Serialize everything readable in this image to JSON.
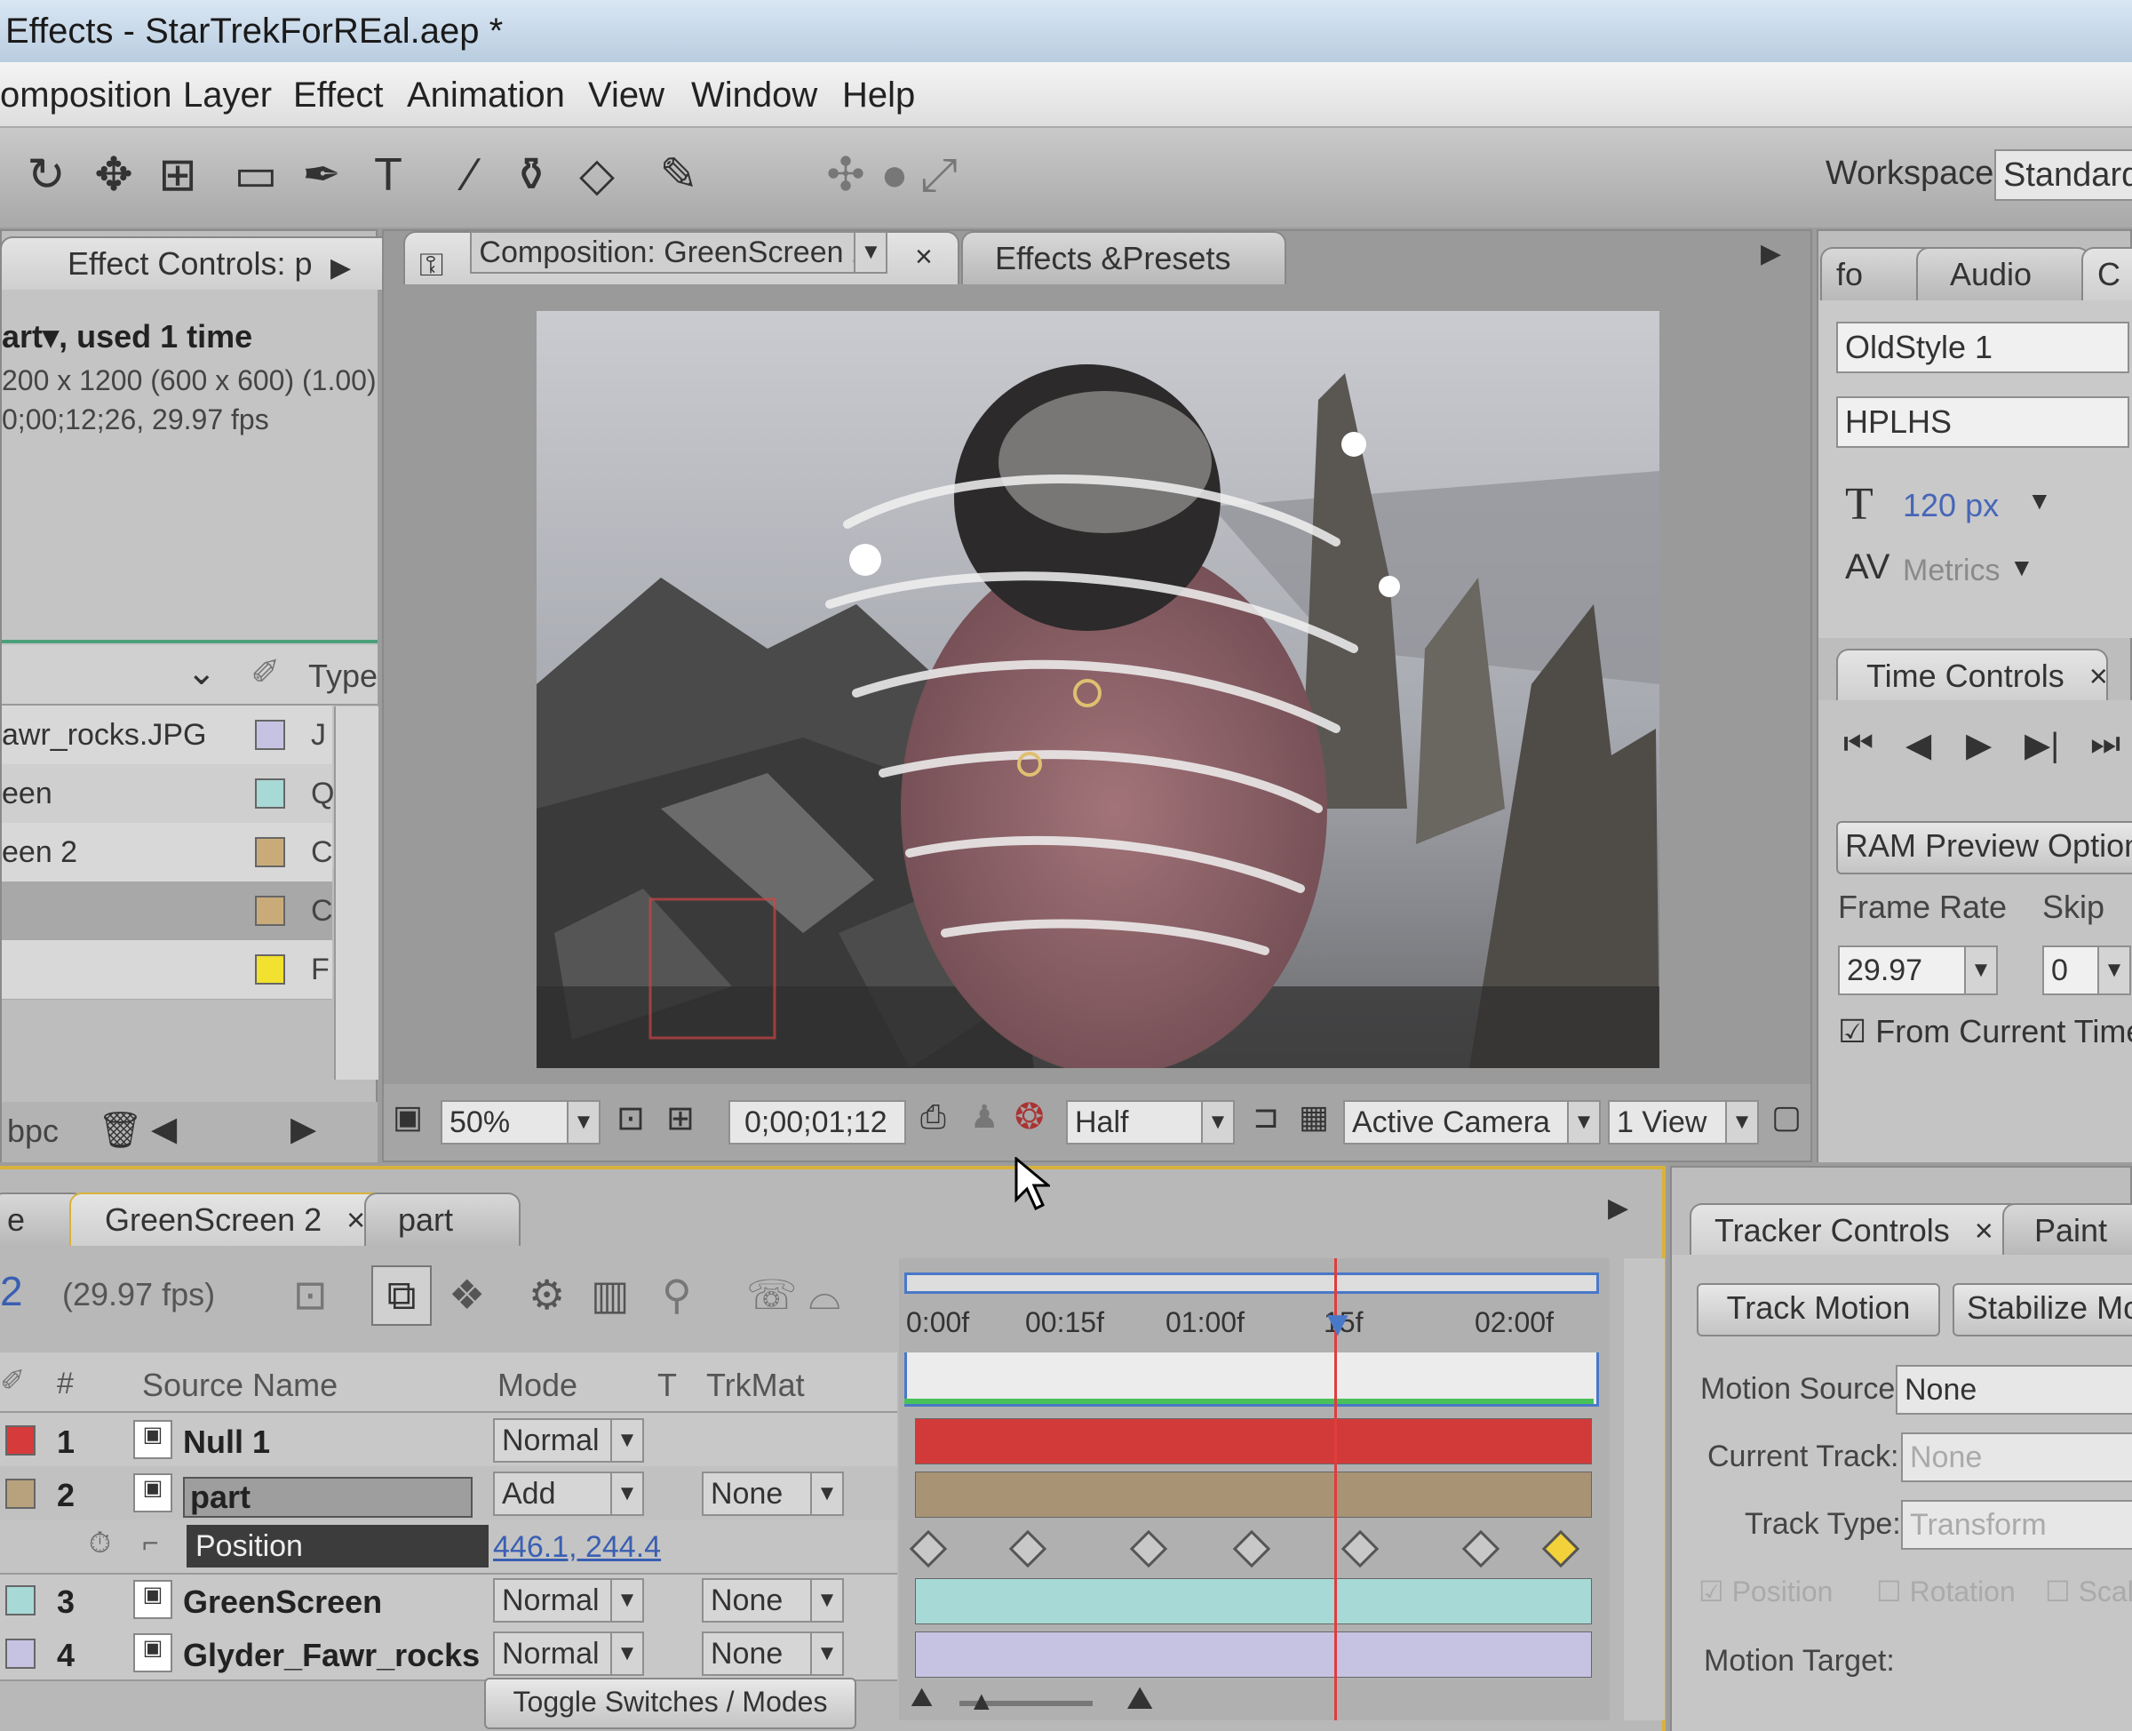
{
  "window": {
    "title": "Effects - StarTrekForREal.aep *"
  },
  "menu": [
    "omposition",
    "Layer",
    "Effect",
    "Animation",
    "View",
    "Window",
    "Help"
  ],
  "toolbar": {
    "workspace_label": "Workspace:",
    "workspace_value": "Standard"
  },
  "effect_controls": {
    "tab": "Effect Controls: p",
    "info_line1": "art▾, used 1 time",
    "info_line2": "200 x 1200  (600 x 600) (1.00)",
    "info_line3": "0;00;12;26, 29.97 fps",
    "col_type": "Type",
    "items": [
      {
        "name": "awr_rocks.JPG",
        "type": "J",
        "color": "#c6c3e2"
      },
      {
        "name": "een",
        "type": "Q",
        "color": "#a7d9d6"
      },
      {
        "name": "een 2",
        "type": "C",
        "color": "#c9ab7a"
      },
      {
        "name": "",
        "type": "C",
        "color": "#c9ab7a"
      },
      {
        "name": "",
        "type": "F",
        "color": "#f2e12e"
      }
    ],
    "footer_bpc": "bpc"
  },
  "composition": {
    "tab": "Composition: GreenScreen 2",
    "tab2": "Effects &Presets",
    "zoom": "50%",
    "timecode": "0;00;01;12",
    "resolution": "Half",
    "camera": "Active Camera",
    "views": "1 View"
  },
  "right_panel": {
    "tabs": [
      "fo",
      "Audio",
      "C"
    ],
    "font_family": "OldStyle 1",
    "font_style": "HPLHS",
    "font_size": "120 px",
    "kerning": "Metrics",
    "time_controls_tab": "Time Controls",
    "ram_preview": "RAM Preview Options",
    "frame_rate_label": "Frame Rate",
    "skip_label": "Skip",
    "frame_rate": "29.97",
    "skip": "0",
    "from_current_time": "From Current Time"
  },
  "timeline": {
    "tabs": [
      "e",
      "GreenScreen 2",
      "part"
    ],
    "comp_num": "2",
    "fps": "(29.97 fps)",
    "ruler": [
      "0:00f",
      "00:15f",
      "01:00f",
      "15f",
      "02:00f"
    ],
    "col_num": "#",
    "col_source": "Source Name",
    "col_mode": "Mode",
    "col_t": "T",
    "col_trkmat": "TrkMat",
    "layers": [
      {
        "num": "1",
        "name": "Null 1",
        "mode": "Normal",
        "trkmat": "",
        "color": "#d73a3a"
      },
      {
        "num": "2",
        "name": "part",
        "mode": "Add",
        "trkmat": "None",
        "color": "#b8a27d"
      },
      {
        "num": "3",
        "name": "GreenScreen",
        "mode": "Normal",
        "trkmat": "None",
        "color": "#a7d9d6"
      },
      {
        "num": "4",
        "name": "Glyder_Fawr_rocks",
        "mode": "Normal",
        "trkmat": "None",
        "color": "#c6c3e2"
      }
    ],
    "property_name": "Position",
    "property_value": "446.1, 244.4",
    "toggle": "Toggle Switches / Modes"
  },
  "tracker": {
    "tabs": [
      "Tracker Controls",
      "Paint"
    ],
    "track_motion": "Track Motion",
    "stabilize": "Stabilize Mot",
    "motion_source_label": "Motion Source:",
    "motion_source": "None",
    "current_track_label": "Current Track:",
    "current_track": "None",
    "track_type_label": "Track Type:",
    "track_type": "Transform",
    "checks": [
      "Position",
      "Rotation",
      "Scal"
    ],
    "motion_target_label": "Motion Target:"
  }
}
